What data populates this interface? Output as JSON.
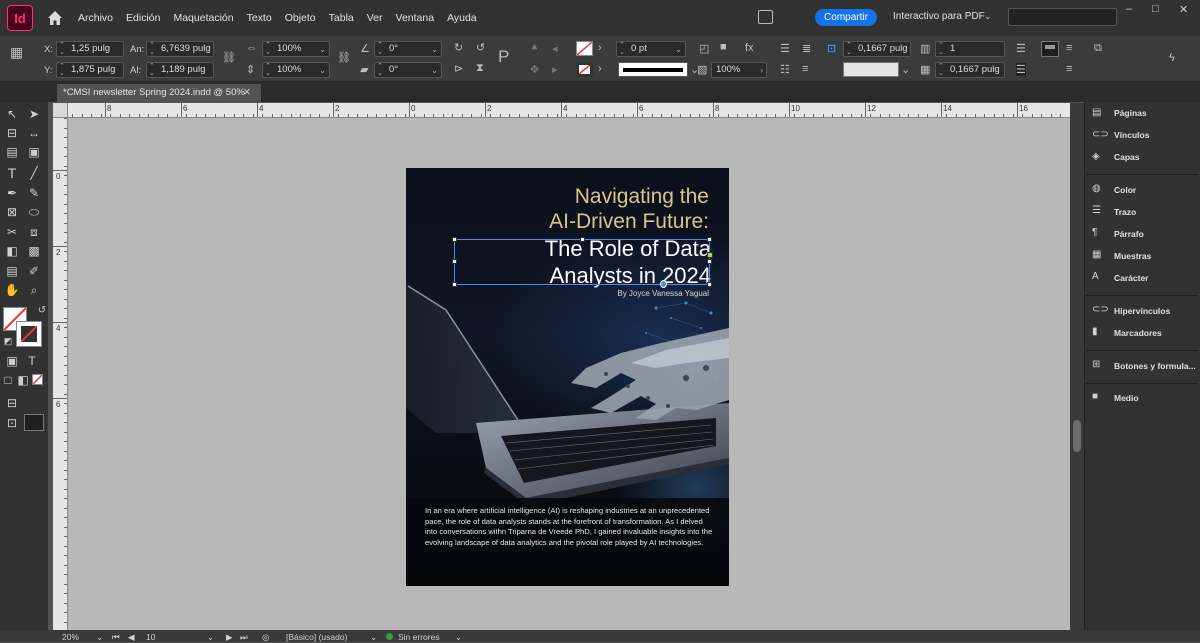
{
  "app": {
    "logo": "Id",
    "menu": [
      "Archivo",
      "Edición",
      "Maquetación",
      "Texto",
      "Objeto",
      "Tabla",
      "Ver",
      "Ventana",
      "Ayuda"
    ],
    "share_label": "Compartir",
    "workspace_label": "Interactivo para PDF",
    "window_controls": [
      "–",
      "□",
      "✕"
    ]
  },
  "control_panel": {
    "x_label": "X:",
    "x_value": "1,25 pulg",
    "y_label": "Y:",
    "y_value": "1,875 pulg",
    "w_label": "An:",
    "w_value": "6,7639 pulg",
    "h_label": "Al:",
    "h_value": "1,189 pulg",
    "scale_x": "100%",
    "scale_y": "100%",
    "rotate": "0°",
    "shear": "0°",
    "stroke_weight": "0 pt",
    "opacity": "100%",
    "inset": "0,1667 pulg",
    "columns": "1",
    "gutter": "0,1667 pulg"
  },
  "document_tab": {
    "title": "*CMSI newsletter Spring 2024.indd @ 50%",
    "close": "✕"
  },
  "ruler_top_labels": [
    "8",
    "6",
    "4",
    "2",
    "0",
    "2",
    "4",
    "6",
    "8",
    "10",
    "12",
    "14",
    "16"
  ],
  "ruler_left_labels": [
    "0",
    "2",
    "4",
    "6"
  ],
  "page": {
    "title_line1": "Navigating the",
    "title_line2": "AI-Driven Future:",
    "title_line3": "The Role of Data",
    "title_line4": "Analysts in 2024",
    "byline": "By Joyce Vanessa Yagual",
    "body": "In an era where artificial intelligence (AI) is reshaping industries at an unprecedented pace, the role of data analysts stands at the forefront of transformation. As I delved into conversations withn Triparna de Vreede PhD, I gained invaluable insights into the evolving landscape of data analytics and the pivotal role played by AI technologies."
  },
  "panels": [
    {
      "label": "Páginas",
      "icon": "pages-icon"
    },
    {
      "label": "Vínculos",
      "icon": "links-icon"
    },
    {
      "label": "Capas",
      "icon": "layers-icon"
    },
    {
      "label": "Color",
      "icon": "color-icon"
    },
    {
      "label": "Trazo",
      "icon": "stroke-icon"
    },
    {
      "label": "Párrafo",
      "icon": "paragraph-icon"
    },
    {
      "label": "Muestras",
      "icon": "swatches-icon"
    },
    {
      "label": "Carácter",
      "icon": "character-icon"
    },
    {
      "label": "Hipervínculos",
      "icon": "hyperlinks-icon"
    },
    {
      "label": "Marcadores",
      "icon": "bookmarks-icon"
    },
    {
      "label": "Botones y formula...",
      "icon": "buttons-forms-icon"
    },
    {
      "label": "Medio",
      "icon": "media-icon"
    }
  ],
  "status": {
    "zoom": "20%",
    "page_number": "10",
    "master": "[Básico] (usado)",
    "preflight": "Sin errores"
  },
  "colors": {
    "accent": "#1473e6",
    "title_gold": "#d9c48c",
    "preflight_ok": "#2ea043"
  }
}
